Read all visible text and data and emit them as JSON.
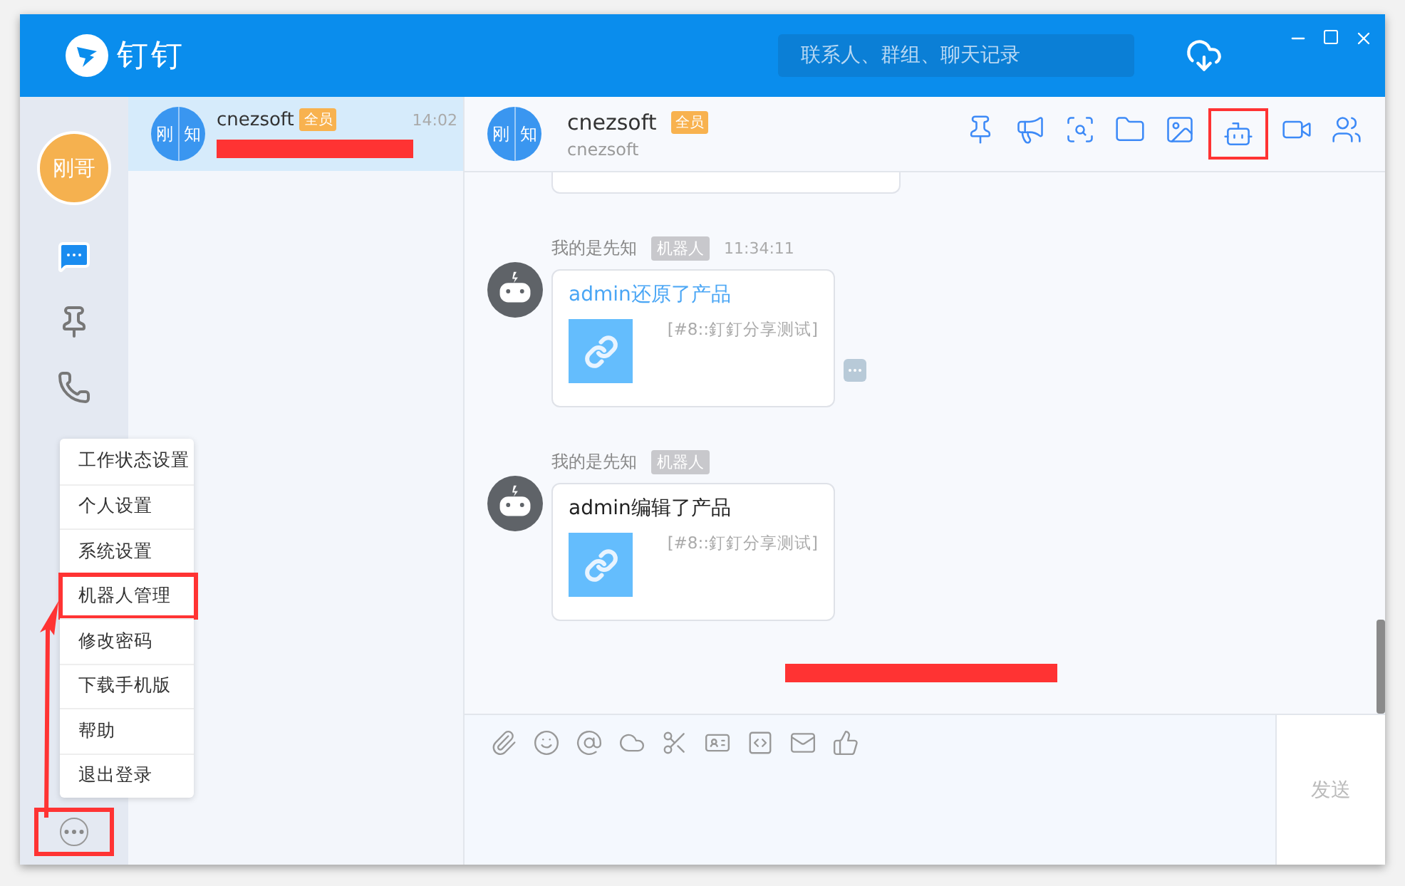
{
  "window": {
    "title": "钉钉",
    "search": {
      "placeholder": "联系人、群组、聊天记录"
    }
  },
  "nav": {
    "user_avatar": "刚哥",
    "items": [
      {
        "kind": "chat",
        "selected": true
      },
      {
        "kind": "pin",
        "selected": false
      },
      {
        "kind": "phone",
        "selected": false
      }
    ],
    "more_marked": true
  },
  "menu": {
    "items": [
      {
        "label": "工作状态设置",
        "marked": false
      },
      {
        "label": "个人设置",
        "marked": false
      },
      {
        "label": "系统设置",
        "marked": false
      },
      {
        "label": "机器人管理",
        "marked": true
      },
      {
        "label": "修改密码",
        "marked": false
      },
      {
        "label": "下载手机版",
        "marked": false
      },
      {
        "label": "帮助",
        "marked": false
      },
      {
        "label": "退出登录",
        "marked": false
      }
    ]
  },
  "conversations": [
    {
      "avatar": [
        "刚",
        "知"
      ],
      "name": "cnezsoft",
      "badge": "全员",
      "time": "14:02",
      "preview_redacted": true,
      "selected": true
    }
  ],
  "chat": {
    "avatar": [
      "刚",
      "知"
    ],
    "name": "cnezsoft",
    "badge": "全员",
    "subtitle": "cnezsoft",
    "tools": [
      {
        "kind": "pin",
        "marked": false
      },
      {
        "kind": "megaphone",
        "marked": false
      },
      {
        "kind": "search",
        "marked": false
      },
      {
        "kind": "folder",
        "marked": false
      },
      {
        "kind": "image",
        "marked": false
      },
      {
        "kind": "robot",
        "marked": true
      },
      {
        "kind": "video",
        "marked": false
      },
      {
        "kind": "contacts",
        "marked": false
      }
    ],
    "messages": [
      {
        "sender": "我的是先知",
        "tag": "机器人",
        "time": "11:34:11",
        "title": "admin还原了产品",
        "title_link": true,
        "link_text": "[#8::釘釘分享测试]",
        "more": true
      },
      {
        "sender": "我的是先知",
        "tag": "机器人",
        "title": "admin编辑了产品",
        "title_link": false,
        "link_text": "[#8::釘釘分享测试]",
        "more": false
      }
    ],
    "redacted_note": true
  },
  "composer": {
    "tools": [
      {
        "kind": "attach"
      },
      {
        "kind": "emoji"
      },
      {
        "kind": "mention"
      },
      {
        "kind": "cloud"
      },
      {
        "kind": "scissors"
      },
      {
        "kind": "card"
      },
      {
        "kind": "code"
      },
      {
        "kind": "mail"
      },
      {
        "kind": "like"
      }
    ],
    "send": "发送"
  }
}
